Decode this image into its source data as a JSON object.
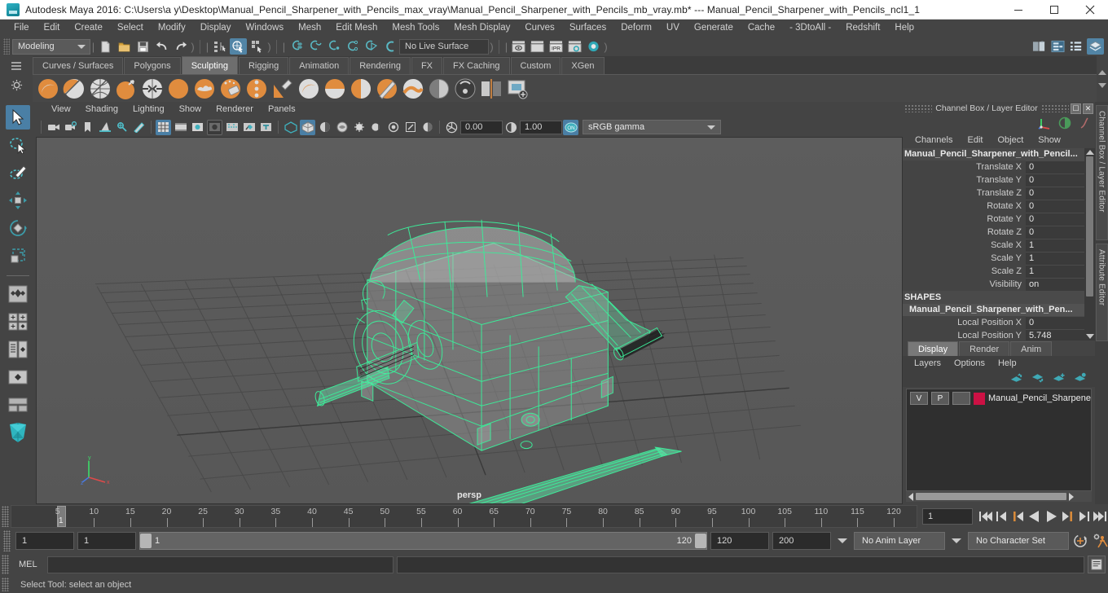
{
  "window": {
    "title": "Autodesk Maya 2016: C:\\Users\\a y\\Desktop\\Manual_Pencil_Sharpener_with_Pencils_max_vray\\Manual_Pencil_Sharpener_with_Pencils_mb_vray.mb*  ---  Manual_Pencil_Sharpener_with_Pencils_ncl1_1",
    "minimize": "–",
    "maximize": "❐",
    "close": "✕"
  },
  "menubar": {
    "items": [
      "File",
      "Edit",
      "Create",
      "Select",
      "Modify",
      "Display",
      "Windows",
      "Mesh",
      "Edit Mesh",
      "Mesh Tools",
      "Mesh Display",
      "Curves",
      "Surfaces",
      "Deform",
      "UV",
      "Generate",
      "Cache",
      "- 3DtoAll -",
      "Redshift",
      "Help"
    ]
  },
  "statusbar": {
    "mode": "Modeling",
    "live_surface": "No Live Surface"
  },
  "shelf": {
    "tabs": [
      "Curves / Surfaces",
      "Polygons",
      "Sculpting",
      "Rigging",
      "Animation",
      "Rendering",
      "FX",
      "FX Caching",
      "Custom",
      "XGen"
    ],
    "active_tab": "Sculpting"
  },
  "viewport": {
    "menus": [
      "View",
      "Shading",
      "Lighting",
      "Show",
      "Renderer",
      "Panels"
    ],
    "exposure": "0.00",
    "gamma_value": "1.00",
    "color_management": "sRGB gamma",
    "camera_label": "persp",
    "axis_x": "x",
    "axis_y": "y",
    "axis_z": "z"
  },
  "channel_box": {
    "panel_title": "Channel Box / Layer Editor",
    "menus": [
      "Channels",
      "Edit",
      "Object",
      "Show"
    ],
    "object_name": "Manual_Pencil_Sharpener_with_Pencil...",
    "attributes": [
      {
        "label": "Translate X",
        "value": "0"
      },
      {
        "label": "Translate Y",
        "value": "0"
      },
      {
        "label": "Translate Z",
        "value": "0"
      },
      {
        "label": "Rotate X",
        "value": "0"
      },
      {
        "label": "Rotate Y",
        "value": "0"
      },
      {
        "label": "Rotate Z",
        "value": "0"
      },
      {
        "label": "Scale X",
        "value": "1"
      },
      {
        "label": "Scale Y",
        "value": "1"
      },
      {
        "label": "Scale Z",
        "value": "1"
      },
      {
        "label": "Visibility",
        "value": "on"
      }
    ],
    "shapes_header": "SHAPES",
    "shape_name": "Manual_Pencil_Sharpener_with_Pen...",
    "shape_attributes": [
      {
        "label": "Local Position X",
        "value": "0"
      },
      {
        "label": "Local Position Y",
        "value": "5.748"
      }
    ],
    "side_tabs": [
      "Channel Box / Layer Editor",
      "Attribute Editor"
    ]
  },
  "layer_editor": {
    "tabs": [
      "Display",
      "Render",
      "Anim"
    ],
    "active_tab": "Display",
    "menus": [
      "Layers",
      "Options",
      "Help"
    ],
    "layers": [
      {
        "visibility": "V",
        "playback": "P",
        "shading": "",
        "color": "#cc1144",
        "name": "Manual_Pencil_Sharpene"
      }
    ]
  },
  "timeline": {
    "ticks": [
      5,
      10,
      15,
      20,
      25,
      30,
      35,
      40,
      45,
      50,
      55,
      60,
      65,
      70,
      75,
      80,
      85,
      90,
      95,
      100,
      105,
      110,
      115,
      120
    ],
    "current_frame": "1",
    "cursor_label": "1"
  },
  "range": {
    "start_field": "1",
    "anim_start_field": "1",
    "range_start": "1",
    "range_end": "120",
    "anim_end_field": "120",
    "playback_end_field": "200",
    "anim_layer": "No Anim Layer",
    "character_set": "No Character Set"
  },
  "command_line": {
    "language_label": "MEL",
    "command_value": "",
    "result_value": ""
  },
  "help_line": {
    "text": "Select Tool: select an object"
  },
  "icons": {
    "select_tool": "arrow-cursor-icon",
    "lasso_tool": "lasso-select-icon",
    "paint_select": "paint-select-icon",
    "move_tool": "move-tool-icon",
    "rotate_tool": "rotate-tool-icon",
    "scale_tool": "scale-tool-icon"
  }
}
